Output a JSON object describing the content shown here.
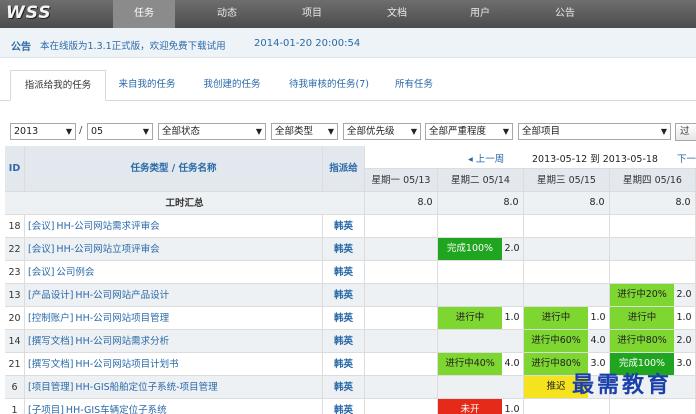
{
  "app": {
    "logo": "WSS"
  },
  "nav": [
    "任务",
    "动态",
    "项目",
    "文档",
    "用户",
    "公告"
  ],
  "announcement": {
    "label": "公告",
    "text": "本在线版为1.3.1正式版，欢迎免费下载试用",
    "time": "2014-01-20 20:00:54"
  },
  "tabs": [
    "指派给我的任务",
    "来自我的任务",
    "我创建的任务",
    "待我审核的任务(7)",
    "所有任务"
  ],
  "filters": {
    "year": "2013",
    "month": "05",
    "status": "全部状态",
    "type": "全部类型",
    "priority": "全部优先级",
    "severity": "全部严重程度",
    "project": "全部项目",
    "go": "过"
  },
  "week_nav": {
    "prev": "◂ 上一周",
    "range": "2013-05-12 到 2013-05-18",
    "next": "下一"
  },
  "columns": {
    "id": "ID",
    "task": "任务类型 / 任务名称",
    "assignee": "指派给",
    "days": [
      "星期一 05/13",
      "星期二 05/14",
      "星期三 05/15",
      "星期四 05/16"
    ]
  },
  "summary": {
    "label": "工时汇总",
    "hours": [
      "8.0",
      "8.0",
      "8.0",
      "8.0"
    ]
  },
  "rows": [
    {
      "id": "18",
      "type": "[会议]",
      "name": "HH-公司网站需求评审会",
      "assignee": "韩英",
      "cells": [
        null,
        null,
        null,
        null
      ]
    },
    {
      "id": "22",
      "type": "[会议]",
      "name": "HH-公司网站立项评审会",
      "assignee": "韩英",
      "cells": [
        null,
        {
          "status": "完成100%",
          "hours": "2.0",
          "color": "#1fa51f"
        },
        null,
        null
      ]
    },
    {
      "id": "23",
      "type": "[会议]",
      "name": "公司例会",
      "assignee": "韩英",
      "cells": [
        null,
        null,
        null,
        null
      ]
    },
    {
      "id": "13",
      "type": "[产品设计]",
      "name": "HH-公司网站产品设计",
      "assignee": "韩英",
      "cells": [
        null,
        null,
        null,
        {
          "status": "进行中20%",
          "hours": "2.0",
          "color": "#7ed631"
        }
      ]
    },
    {
      "id": "20",
      "type": "[控制账户]",
      "name": "HH-公司网站项目管理",
      "assignee": "韩英",
      "cells": [
        null,
        {
          "status": "进行中",
          "hours": "1.0",
          "color": "#7ed631"
        },
        {
          "status": "进行中",
          "hours": "1.0",
          "color": "#7ed631"
        },
        {
          "status": "进行中",
          "hours": "1.0",
          "color": "#7ed631"
        }
      ]
    },
    {
      "id": "14",
      "type": "[撰写文档]",
      "name": "HH-公司网站需求分析",
      "assignee": "韩英",
      "cells": [
        null,
        null,
        {
          "status": "进行中60%",
          "hours": "4.0",
          "color": "#7ed631"
        },
        {
          "status": "进行中80%",
          "hours": "2.0",
          "color": "#7ed631"
        }
      ]
    },
    {
      "id": "21",
      "type": "[撰写文档]",
      "name": "HH-公司网站项目计划书",
      "assignee": "韩英",
      "cells": [
        null,
        {
          "status": "进行中40%",
          "hours": "4.0",
          "color": "#7ed631"
        },
        {
          "status": "进行中80%",
          "hours": "3.0",
          "color": "#7ed631"
        },
        {
          "status": "完成100%",
          "hours": "3.0",
          "color": "#1fa51f"
        }
      ]
    },
    {
      "id": "6",
      "type": "[项目管理]",
      "name": "HH-GIS船舶定位子系统-项目管理",
      "assignee": "韩英",
      "cells": [
        null,
        null,
        {
          "status": "推迟",
          "hours": "",
          "color": "#f5e31f"
        },
        null
      ]
    },
    {
      "id": "1",
      "type": "[子项目]",
      "name": "HH-GIS车辆定位子系统",
      "assignee": "韩英",
      "cells": [
        null,
        {
          "status": "未开",
          "hours": "1.0",
          "color": "#e52a1a"
        },
        null,
        null
      ]
    }
  ],
  "colors": {
    "done": "#1fa51f",
    "in_progress": "#7ed631",
    "delayed": "#f5e31f",
    "not_started": "#e52a1a",
    "header_bg": "#e3e8ee",
    "link": "#2a6aa8"
  },
  "watermark": "最需教育"
}
